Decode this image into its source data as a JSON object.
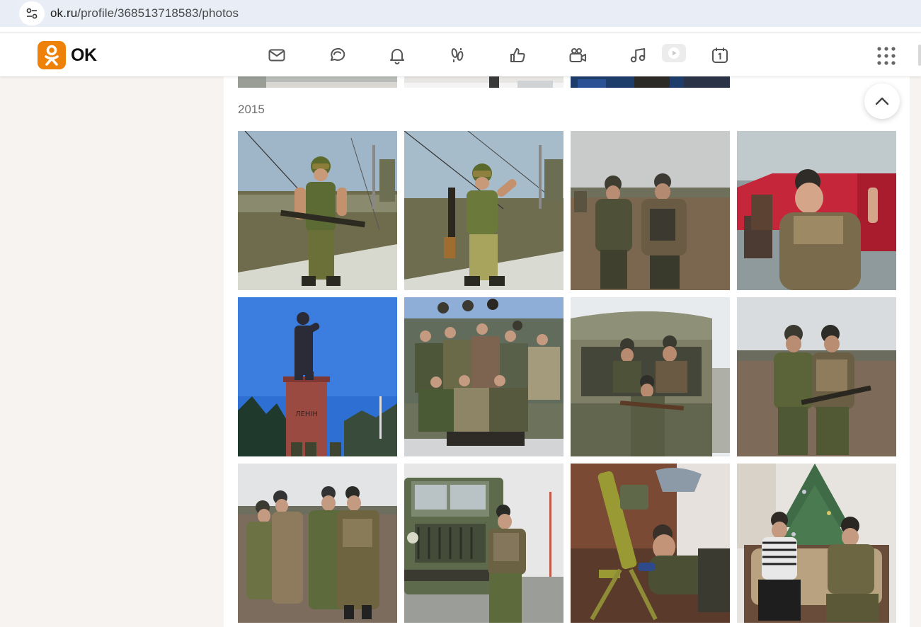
{
  "browser": {
    "url_host": "ok.ru",
    "url_path": "/profile/368513718583/photos"
  },
  "brand": {
    "logo_text": "OK",
    "accent": "#ee8208"
  },
  "nav": [
    {
      "name": "messages-icon"
    },
    {
      "name": "discussions-icon"
    },
    {
      "name": "notifications-icon"
    },
    {
      "name": "guests-icon"
    },
    {
      "name": "likes-icon"
    },
    {
      "name": "video-calls-icon"
    },
    {
      "name": "music-icon"
    },
    {
      "name": "video-icon"
    },
    {
      "name": "calendar-icon"
    },
    {
      "name": "apps-grid-icon"
    }
  ],
  "gallery": {
    "year": "2015",
    "photos": [
      {
        "desc": "soldier-helmet-rifle-rooftop"
      },
      {
        "desc": "soldier-goggles-rifle-victory-sign"
      },
      {
        "desc": "two-men-field"
      },
      {
        "desc": "man-beret-red-truck-victory-sign"
      },
      {
        "desc": "lenin-statue-monument",
        "sign": "ЛЕНІН"
      },
      {
        "desc": "group-of-soldiers"
      },
      {
        "desc": "soldiers-in-truck"
      },
      {
        "desc": "two-soldiers-field"
      },
      {
        "desc": "group-four-soldiers-field"
      },
      {
        "desc": "man-beside-military-truck"
      },
      {
        "desc": "man-with-weapon-indoors"
      },
      {
        "desc": "two-men-christmas-tree"
      }
    ]
  }
}
